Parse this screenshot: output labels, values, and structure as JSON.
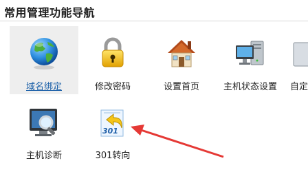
{
  "panel": {
    "title": "常用管理功能导航"
  },
  "tiles": [
    {
      "label": "域名绑定",
      "icon": "globe-icon",
      "selected": true
    },
    {
      "label": "修改密码",
      "icon": "padlock-icon",
      "selected": false
    },
    {
      "label": "设置首页",
      "icon": "house-icon",
      "selected": false
    },
    {
      "label": "主机状态设置",
      "icon": "server-monitor-icon",
      "selected": false
    },
    {
      "label": "自定",
      "icon": "custom-icon",
      "selected": false
    },
    {
      "label": "主机诊断",
      "icon": "monitor-magnifier-icon",
      "selected": false
    },
    {
      "label": "301转向",
      "icon": "redirect-301-icon",
      "selected": false
    }
  ],
  "colors": {
    "selected_bg": "#eeeeee",
    "selected_label": "#1a5fa8",
    "arrow": "#e53935"
  }
}
